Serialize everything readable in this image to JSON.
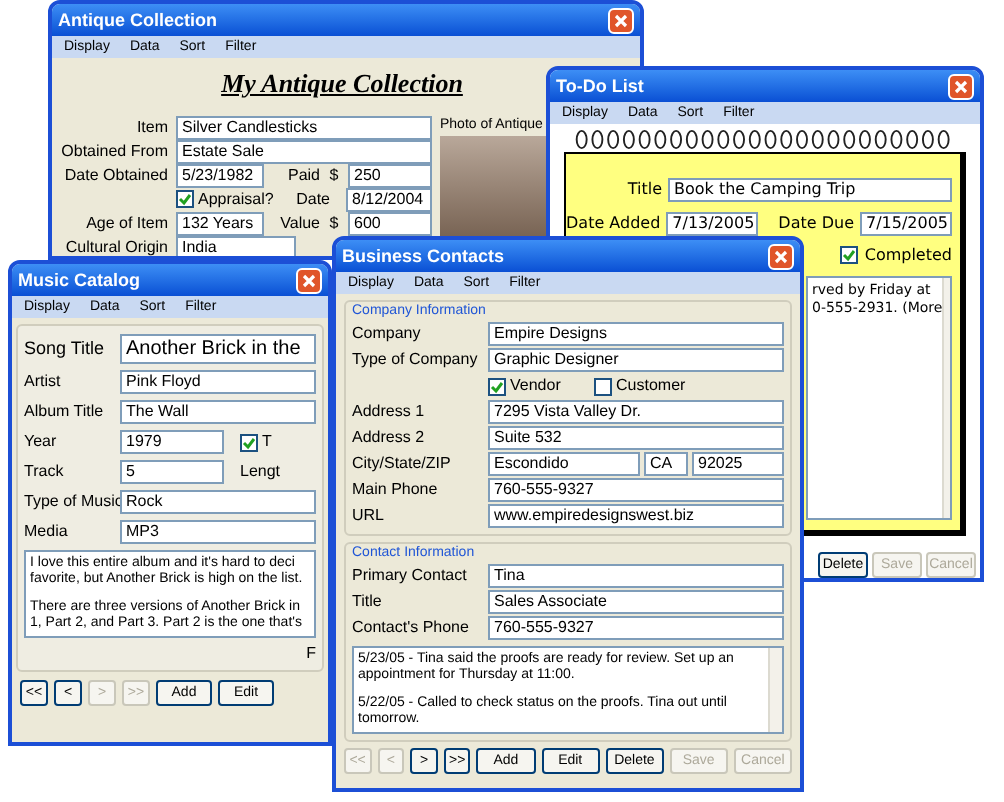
{
  "antique_window": {
    "title": "Antique Collection",
    "menu": [
      "Display",
      "Data",
      "Sort",
      "Filter"
    ],
    "heading": "My Antique Collection",
    "item": {
      "label": "Item",
      "value": "Silver Candlesticks"
    },
    "obtained_from": {
      "label": "Obtained From",
      "value": "Estate Sale"
    },
    "date_obtained": {
      "label": "Date Obtained",
      "value": "5/23/1982"
    },
    "paid": {
      "label": "Paid",
      "currency": "$",
      "value": "250"
    },
    "appraisal": {
      "label": "Appraisal?",
      "checked": true
    },
    "appraisal_date": {
      "label": "Date",
      "value": "8/12/2004"
    },
    "age": {
      "label": "Age of Item",
      "value": "132 Years"
    },
    "item_value": {
      "label": "Value",
      "currency": "$",
      "value": "600"
    },
    "cultural_origin": {
      "label": "Cultural Origin",
      "value": "India"
    },
    "photo_label": "Photo of Antique"
  },
  "todo_window": {
    "title": "To-Do List",
    "menu": [
      "Display",
      "Data",
      "Sort",
      "Filter"
    ],
    "title_field": {
      "label": "Title",
      "value": "Book the Camping Trip"
    },
    "date_added": {
      "label": "Date Added",
      "value": "7/13/2005"
    },
    "date_due": {
      "label": "Date Due",
      "value": "7/15/2005"
    },
    "completed": {
      "label": "Completed",
      "checked": true
    },
    "notes": [
      "rved by Friday at",
      "0-555-2931. (More"
    ],
    "buttons": [
      {
        "label": "Delete",
        "disabled": false
      },
      {
        "label": "Save",
        "disabled": true
      },
      {
        "label": "Cancel",
        "disabled": true
      }
    ]
  },
  "music_window": {
    "title": "Music Catalog",
    "menu": [
      "Display",
      "Data",
      "Sort",
      "Filter"
    ],
    "song_title": {
      "label": "Song Title",
      "value": "Another Brick in the"
    },
    "artist": {
      "label": "Artist",
      "value": "Pink Floyd"
    },
    "album_title": {
      "label": "Album Title",
      "value": "The Wall"
    },
    "year": {
      "label": "Year",
      "value": "1979"
    },
    "checkbox": {
      "label": "T",
      "checked": true
    },
    "track": {
      "label": "Track",
      "value": "5"
    },
    "length_label": "Lengt",
    "type_of_music": {
      "label": "Type of Music",
      "value": "Rock"
    },
    "media": {
      "label": "Media",
      "value": "MP3"
    },
    "notes": [
      [
        "I love this entire album and it's hard to deci",
        "favorite, but Another Brick is high on the list."
      ],
      [
        "There are three versions of Another Brick in",
        "1, Part 2, and Part 3. Part 2 is the one that's"
      ]
    ],
    "footer_label": "F",
    "buttons": [
      {
        "label": "<<",
        "disabled": false
      },
      {
        "label": "<",
        "disabled": false
      },
      {
        "label": ">",
        "disabled": true
      },
      {
        "label": ">>",
        "disabled": true
      },
      {
        "label": "Add",
        "disabled": false
      },
      {
        "label": "Edit",
        "disabled": false
      }
    ]
  },
  "business_window": {
    "title": "Business Contacts",
    "menu": [
      "Display",
      "Data",
      "Sort",
      "Filter"
    ],
    "company_group": {
      "legend": "Company Information",
      "company": {
        "label": "Company",
        "value": "Empire Designs"
      },
      "type_of_company": {
        "label": "Type of Company",
        "value": "Graphic Designer"
      },
      "vendor": {
        "label": "Vendor",
        "checked": true
      },
      "customer": {
        "label": "Customer",
        "checked": false
      },
      "address_1": {
        "label": "Address 1",
        "value": "7295 Vista Valley Dr."
      },
      "address_2": {
        "label": "Address 2",
        "value": "Suite 532"
      },
      "city_state_zip": {
        "label": "City/State/ZIP",
        "city": "Escondido",
        "state": "CA",
        "zip": "92025"
      },
      "main_phone": {
        "label": "Main Phone",
        "value": "760-555-9327"
      },
      "url": {
        "label": "URL",
        "value": "www.empiredesignswest.biz"
      }
    },
    "contact_group": {
      "legend": "Contact Information",
      "primary_contact": {
        "label": "Primary Contact",
        "value": "Tina"
      },
      "title": {
        "label": "Title",
        "value": "Sales Associate"
      },
      "phone": {
        "label": "Contact's Phone",
        "value": "760-555-9327"
      },
      "notes": [
        "5/23/05 - Tina said the proofs are ready for review. Set up an appointment for Thursday at 11:00.",
        "5/22/05 - Called to check status on the proofs. Tina out until tomorrow."
      ]
    },
    "buttons": [
      {
        "label": "<<",
        "disabled": true
      },
      {
        "label": "<",
        "disabled": true
      },
      {
        "label": ">",
        "disabled": false
      },
      {
        "label": ">>",
        "disabled": false
      },
      {
        "label": "Add",
        "disabled": false
      },
      {
        "label": "Edit",
        "disabled": false
      },
      {
        "label": "Delete",
        "disabled": false
      },
      {
        "label": "Save",
        "disabled": true
      },
      {
        "label": "Cancel",
        "disabled": true
      }
    ]
  }
}
